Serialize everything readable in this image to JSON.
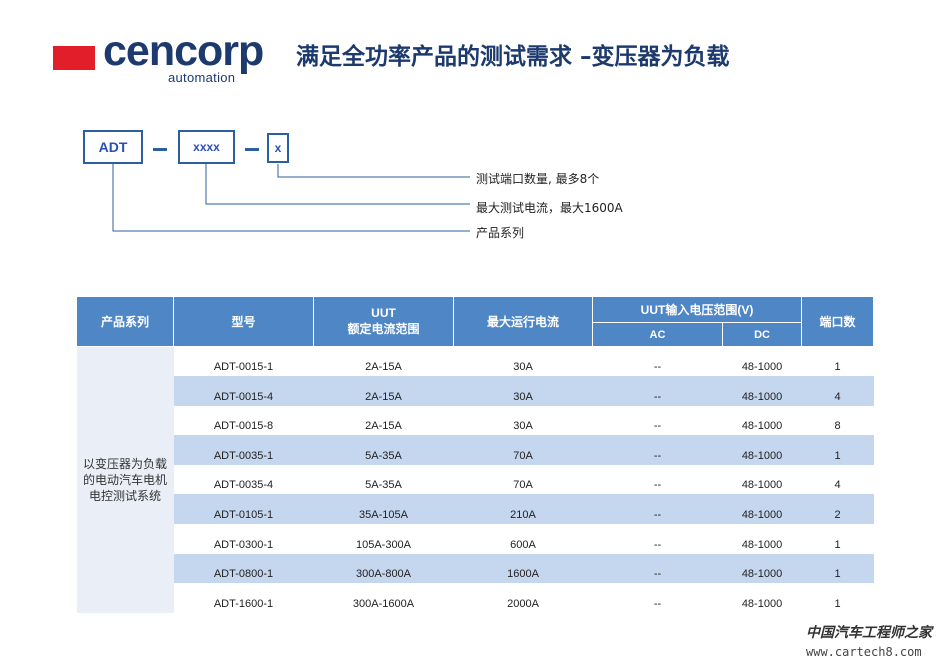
{
  "header": {
    "logo_word": "cencorp",
    "logo_sub": "automation",
    "title": "满足全功率产品的测试需求 –变压器为负载",
    "logo_color": "#1d3a6e",
    "logo_accent": "#e21e2a"
  },
  "diagram": {
    "code_series": "ADT",
    "code_current": "xxxx",
    "code_ports": "x",
    "label_ports": "测试端口数量, 最多8个",
    "label_current": "最大测试电流，最大1600A",
    "label_series": "产品系列"
  },
  "table": {
    "headers": {
      "series": "产品系列",
      "model": "型号",
      "rated_current_line1": "UUT",
      "rated_current_line2": "额定电流范围",
      "max_current": "最大运行电流",
      "voltage_range": "UUT输入电压范围(V)",
      "ac": "AC",
      "dc": "DC",
      "ports": "端口数"
    },
    "series_lines": [
      "以变压器为负载",
      "的电动汽车电机",
      "电控测试系统"
    ],
    "rows": [
      {
        "model": "ADT-0015-1",
        "rated": "2A-15A",
        "max": "30A",
        "ac": "--",
        "dc": "48-1000",
        "ports": "1"
      },
      {
        "model": "ADT-0015-4",
        "rated": "2A-15A",
        "max": "30A",
        "ac": "--",
        "dc": "48-1000",
        "ports": "4"
      },
      {
        "model": "ADT-0015-8",
        "rated": "2A-15A",
        "max": "30A",
        "ac": "--",
        "dc": "48-1000",
        "ports": "8"
      },
      {
        "model": "ADT-0035-1",
        "rated": "5A-35A",
        "max": "70A",
        "ac": "--",
        "dc": "48-1000",
        "ports": "1"
      },
      {
        "model": "ADT-0035-4",
        "rated": "5A-35A",
        "max": "70A",
        "ac": "--",
        "dc": "48-1000",
        "ports": "4"
      },
      {
        "model": "ADT-0105-1",
        "rated": "35A-105A",
        "max": "210A",
        "ac": "--",
        "dc": "48-1000",
        "ports": "2"
      },
      {
        "model": "ADT-0300-1",
        "rated": "105A-300A",
        "max": "600A",
        "ac": "--",
        "dc": "48-1000",
        "ports": "1"
      },
      {
        "model": "ADT-0800-1",
        "rated": "300A-800A",
        "max": "1600A",
        "ac": "--",
        "dc": "48-1000",
        "ports": "1"
      },
      {
        "model": "ADT-1600-1",
        "rated": "300A-1600A",
        "max": "2000A",
        "ac": "--",
        "dc": "48-1000",
        "ports": "1"
      }
    ],
    "header_color": "#4f86c6",
    "stripe_color": "#c5d6ef"
  },
  "watermark": {
    "cn": "中国汽车工程师之家",
    "url": "www.cartech8.com"
  }
}
